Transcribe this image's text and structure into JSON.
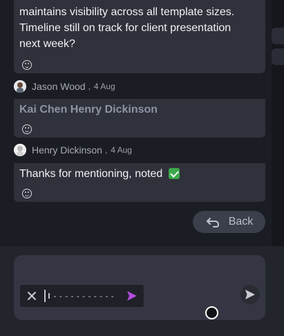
{
  "messages": [
    {
      "text_lines": [
        "maintains visibility across all template sizes.",
        "Timeline still on track for client presentation",
        "next week?"
      ]
    },
    {
      "author": "Jason Wood",
      "date": "4 Aug",
      "text": "Kai Chen Henry Dickinson"
    },
    {
      "author": "Henry Dickinson",
      "date": "4 Aug",
      "text": "Thanks for mentioning, noted",
      "emoji": "✅"
    }
  ],
  "separator": ",",
  "back_button": {
    "label": "Back"
  },
  "voice_recorder": {
    "waveform_placeholder": "- - - - - - - - - - -"
  },
  "icons": {
    "reaction": "smiley-face-icon",
    "close": "close-icon",
    "send": "send-icon",
    "back": "back-arrow-icon"
  },
  "colors": {
    "background": "#1b1d24",
    "bubble": "#2f313b",
    "accent_send": "#b34bdd",
    "back_button": "#3a3f4b"
  }
}
